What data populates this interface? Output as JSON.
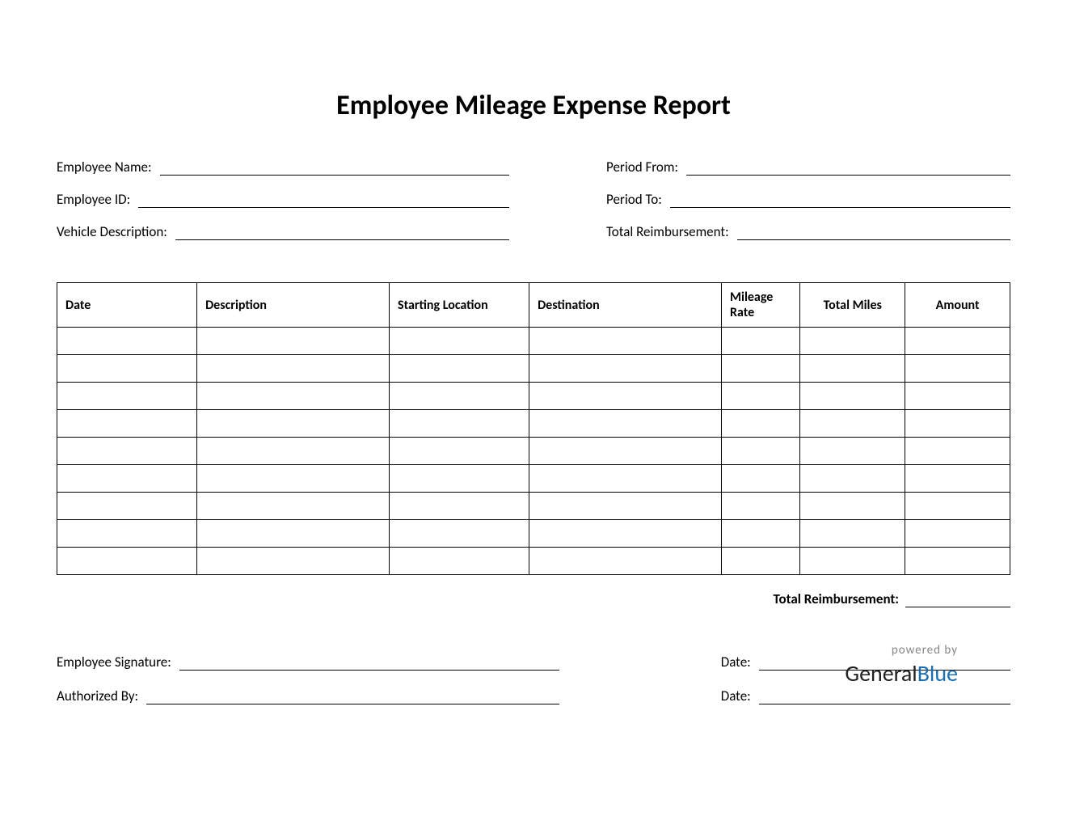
{
  "title": "Employee Mileage Expense Report",
  "fields": {
    "employee_name": "Employee Name:",
    "employee_id": "Employee ID:",
    "vehicle_description": "Vehicle Description:",
    "period_from": "Period From:",
    "period_to": "Period To:",
    "total_reimbursement": "Total Reimbursement:"
  },
  "table": {
    "headers": {
      "date": "Date",
      "description": "Description",
      "starting_location": "Starting Location",
      "destination": "Destination",
      "mileage_rate": "Mileage Rate",
      "total_miles": "Total Miles",
      "amount": "Amount"
    },
    "row_count": 9
  },
  "total": {
    "label": "Total Reimbursement:"
  },
  "signatures": {
    "employee_signature": "Employee Signature:",
    "authorized_by": "Authorized By:",
    "date": "Date:"
  },
  "footer": {
    "powered": "powered by",
    "brand_a": "General",
    "brand_b": "Blue"
  }
}
